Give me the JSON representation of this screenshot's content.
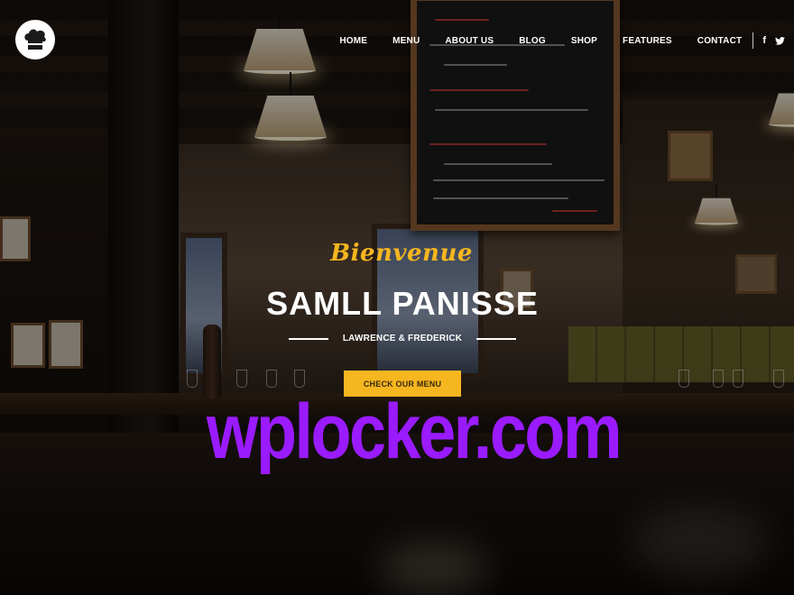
{
  "header": {
    "logo_icon": "chef-hat-icon",
    "nav": [
      {
        "label": "HOME"
      },
      {
        "label": "MENU"
      },
      {
        "label": "ABOUT US"
      },
      {
        "label": "BLOG"
      },
      {
        "label": "SHOP"
      },
      {
        "label": "FEATURES"
      },
      {
        "label": "CONTACT"
      }
    ],
    "social": [
      {
        "icon": "facebook-icon",
        "glyph": "f"
      },
      {
        "icon": "twitter-icon"
      }
    ]
  },
  "hero": {
    "script": "Bienvenue",
    "title": "SAMLL PANISSE",
    "subtitle": "LAWRENCE & FREDERICK",
    "cta_label": "CHECK OUR MENU"
  },
  "watermark": "wplocker.com",
  "colors": {
    "accent": "#f6b61f",
    "watermark": "#9a1bff",
    "text": "#ffffff"
  }
}
